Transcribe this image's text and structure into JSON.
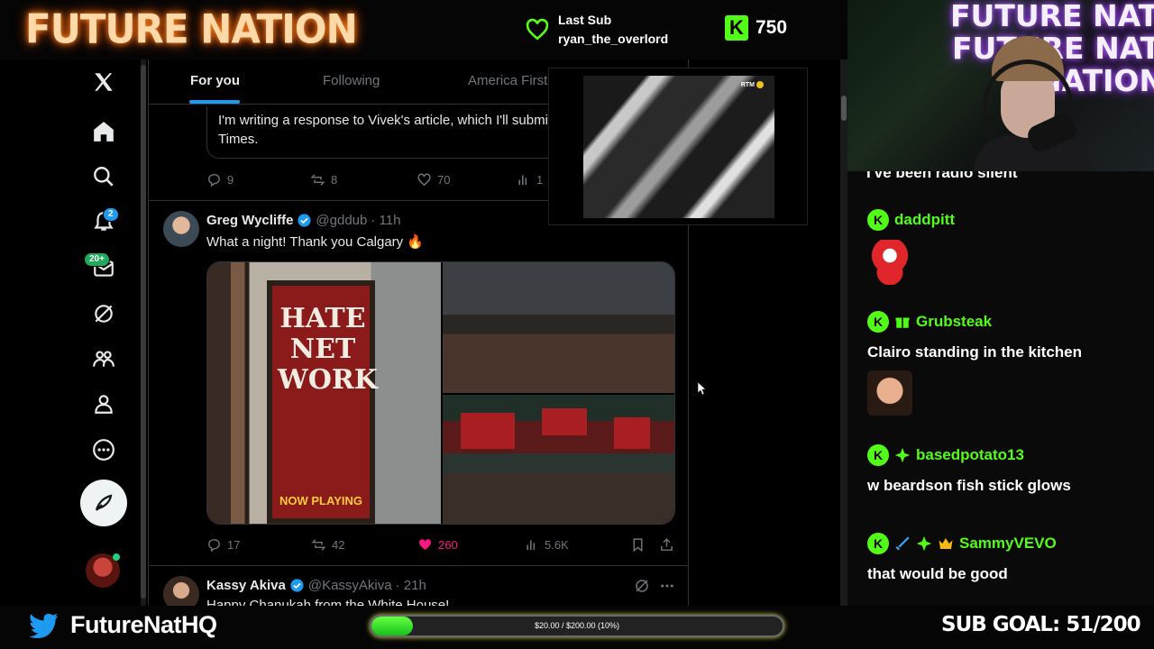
{
  "overlay": {
    "brand": "FUTURE NATION",
    "last_sub_label": "Last Sub",
    "last_sub_user": "ryan_the_overlord",
    "kick_count": "750",
    "kick_letter": "K",
    "twitter_handle": "FutureNatHQ",
    "goal_text": "$20.00 / $200.00 (10%)",
    "goal_fraction": 0.1,
    "sub_goal": "SUB GOAL: 51/200",
    "cam_neon": [
      "FUTURE NATION",
      "FUTURE NATION",
      "NATION"
    ]
  },
  "x_nav": {
    "notifications_badge": "2",
    "messages_badge": "20+"
  },
  "feed": {
    "tabs": [
      "For you",
      "Following",
      "America First"
    ],
    "active_tab": "For you",
    "quote_text": "I'm writing a response to Vivek's article, which I'll submit to the New York Times.",
    "tweet1_actions": {
      "replies": "9",
      "reposts": "8",
      "likes": "70",
      "views": "1"
    },
    "tweet2": {
      "name": "Greg Wycliffe",
      "handle": "@gddub",
      "time": "· 11h",
      "text": "What a night! Thank you Calgary 🔥",
      "poster_title": "HATE NET WORK",
      "poster_tag": "NOW PLAYING",
      "replies": "17",
      "reposts": "42",
      "likes": "260",
      "views": "5.6K"
    },
    "tweet3": {
      "name": "Kassy Akiva",
      "handle": "@KassyAkiva",
      "time": "· 21h",
      "text": "Happy Chanukah from the White House!"
    }
  },
  "video": {
    "logo": "RTM"
  },
  "chat": {
    "cut_text": "I've been radio silent",
    "messages": [
      {
        "user": "daddpitt",
        "text": ""
      },
      {
        "user": "Grubsteak",
        "text": "Clairo standing in the kitchen"
      },
      {
        "user": "basedpotato13",
        "text": "w beardson fish stick glows"
      },
      {
        "user": "SammyVEVO",
        "text": "that would be good"
      }
    ]
  },
  "colors": {
    "kick_green": "#53fc18",
    "twitter_blue": "#1d9bf0",
    "like_pink": "#f91880",
    "brand_glow": "#ff8a2a",
    "cam_neon_glow": "#b060ff"
  },
  "icons": [
    "heart-icon",
    "x-logo-icon",
    "home-icon",
    "search-icon",
    "bell-icon",
    "mail-icon",
    "grok-icon",
    "communities-icon",
    "profile-icon",
    "more-icon",
    "post-icon",
    "reply-icon",
    "repost-icon",
    "like-icon",
    "views-icon",
    "bookmark-icon",
    "share-icon",
    "twitter-bird-icon"
  ]
}
